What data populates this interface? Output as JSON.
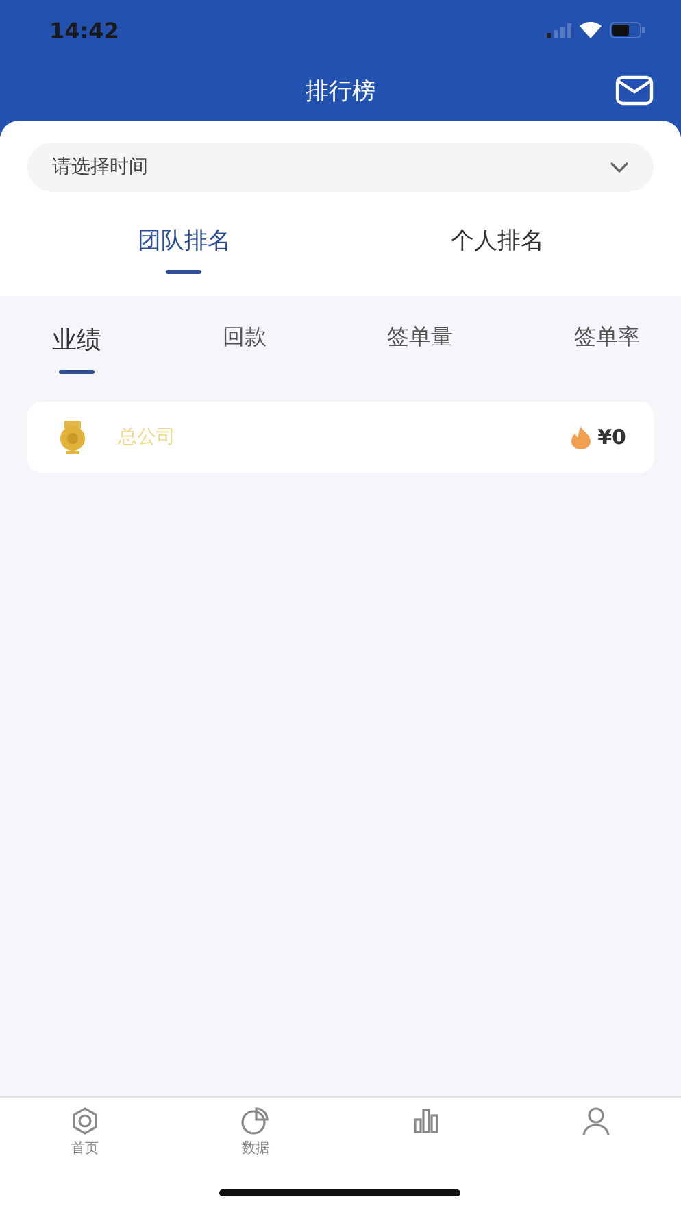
{
  "status_bar": {
    "time": "14:42"
  },
  "header": {
    "title": "排行榜"
  },
  "time_select": {
    "placeholder": "请选择时间"
  },
  "tabs": [
    {
      "label": "团队排名",
      "selected": true
    },
    {
      "label": "个人排名",
      "selected": false
    }
  ],
  "metric_tabs": [
    {
      "label": "业绩",
      "selected": true
    },
    {
      "label": "回款",
      "selected": false
    },
    {
      "label": "签单量",
      "selected": false
    },
    {
      "label": "签单率",
      "selected": false
    }
  ],
  "ranking": [
    {
      "name": "总公司",
      "amount": "¥0"
    }
  ],
  "tab_bar": [
    {
      "kind": "home",
      "label": "首页"
    },
    {
      "kind": "chart",
      "label": "数据"
    },
    {
      "kind": "rank"
    },
    {
      "kind": "user"
    }
  ]
}
